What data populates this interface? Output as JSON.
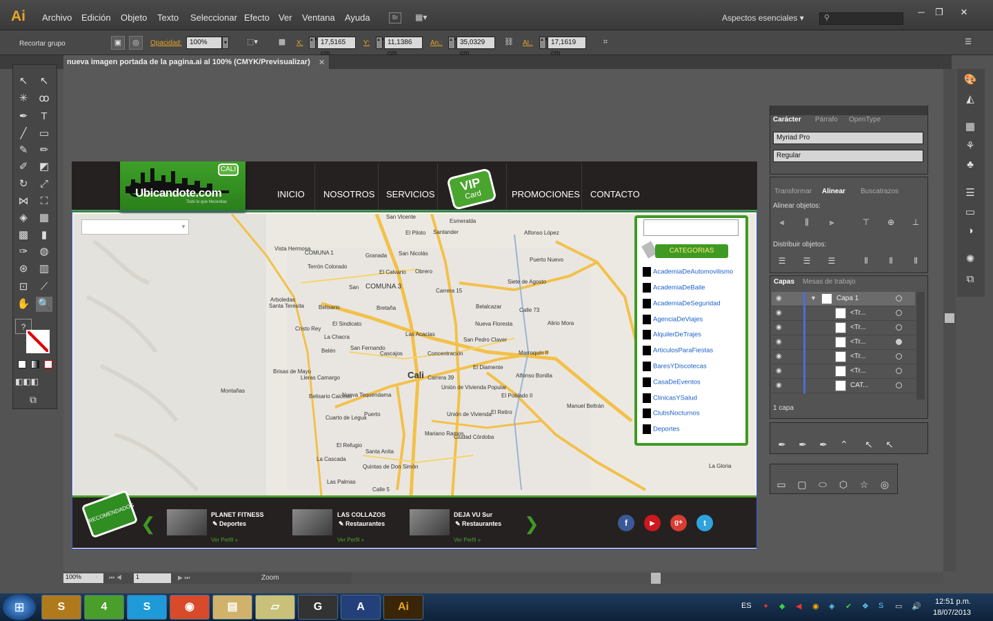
{
  "app": {
    "logo": "Ai",
    "menu": [
      "Archivo",
      "Edición",
      "Objeto",
      "Texto",
      "Seleccionar",
      "Efecto",
      "Ver",
      "Ventana",
      "Ayuda"
    ],
    "bridge": "Br",
    "workspace": "Aspectos esenciales",
    "workspace_caret": "▾",
    "window_controls": [
      "─",
      "❐",
      "✕"
    ]
  },
  "control": {
    "group_label": "Recortar grupo",
    "opacity_label": "Opacidad:",
    "opacity_value": "100%",
    "x_label": "X:",
    "x_value": "17,5165 cm",
    "y_label": "Y:",
    "y_value": "11,1386 cm",
    "w_label": "An.:",
    "w_value": "35,0329 cm",
    "h_label": "Al.:",
    "h_value": "17,1619 cm"
  },
  "document": {
    "tab_title": "nueva imagen portada de la pagina.ai al 100% (CMYK/Previsualizar)",
    "close": "✕"
  },
  "site": {
    "logo_text": "Ubicandote.com",
    "logo_badge": "CALI",
    "logo_sub": "Todo lo que Necesitas",
    "nav": [
      "INICIO",
      "NOSOTROS",
      "SERVICIOS",
      "PROMOCIONES",
      "CONTACTO"
    ],
    "vip_title": "VIP",
    "vip_sub": "Card",
    "categories_title": "CATEGORIAS",
    "categories": [
      "AcademiaDeAutomovilismo",
      "AcademiaDeBaile",
      "AcademiaDeSeguridad",
      "AgenciaDeViajes",
      "AlquilerDeTrajes",
      "ArticulosParaFiestas",
      "BaresYDiscotecas",
      "CasaDeEventos",
      "ClinicasYSalud",
      "ClubsNocturnos",
      "Deportes"
    ],
    "recommended": "RECOMENDADOS",
    "featured": [
      {
        "name": "PLANET FITNESS",
        "category": "Deportes",
        "link": "Ver Perfil »"
      },
      {
        "name": "LAS COLLAZOS",
        "category": "Restaurantes",
        "link": "Ver Perfil »"
      },
      {
        "name": "DEJA VU Sur",
        "category": "Restaurantes",
        "link": "Ver Perfil »"
      }
    ],
    "social": [
      "f",
      "▶",
      "g+",
      "t"
    ]
  },
  "map_labels": [
    "San Vicente",
    "Esmeralda",
    "El Piloto",
    "Santander",
    "Alfonso López",
    "Vista Hermosa",
    "COMUNA 1",
    "Granada",
    "San Nicolás",
    "Terrón Colorado",
    "El Calvario",
    "Obrero",
    "Puerto Nuevo",
    "San",
    "COMUNA 3",
    "Carrera 15",
    "Siete de Agosto",
    "Arboledas",
    "Bretaña",
    "Calle 73",
    "Belisario",
    "Santa Teresita",
    "Belalcazar",
    "El Sindicato",
    "Alirio Mora",
    "La Chacra",
    "Cristo Rey",
    "Nueva Floresta",
    "San Fernando",
    "Las Acacias",
    "San Pedro Claver",
    "Belén",
    "Cascajos",
    "Concentración",
    "El Diamente",
    "Marroquín II",
    "Cali",
    "Carrera 39",
    "Alfonso Bonilla",
    "Brisas de Mayo",
    "Lleras Camargo",
    "Belisario Caicedo",
    "Nueva Tequendama",
    "Unión de Vivienda Popular",
    "El Poblado II",
    "Montañas",
    "Puerto",
    "Cuarto de Legua",
    "Unión de Vivienda",
    "El Retiro",
    "Manuel Beltrán",
    "Mariano Ramos",
    "Ciudad Córdoba",
    "El Refugio",
    "La Cascada",
    "Santa Anita",
    "Quintas de Don Simón",
    "Las Palmas",
    "Calle 5",
    "La Gloria"
  ],
  "layers": {
    "tabs": [
      "Capas",
      "Mesas de trabajo"
    ],
    "top": "Capa 1",
    "rows": [
      "<Tr...",
      "<Tr...",
      "<Tr...",
      "<Tr...",
      "<Tr...",
      "CAT..."
    ],
    "count": "1 capa"
  },
  "character": {
    "tabs": [
      "Carácter",
      "Párrafo",
      "OpenType"
    ],
    "font": "Myriad Pro",
    "style": "Regular"
  },
  "align": {
    "tabs": [
      "Transformar",
      "Alinear",
      "Buscatrazos"
    ],
    "align_label": "Alinear objetos:",
    "dist_label": "Distribuir objetos:"
  },
  "status": {
    "zoom": "100%",
    "page": "1",
    "label": "Zoom"
  },
  "taskbar": {
    "lang": "ES",
    "time": "12:51 p.m.",
    "date": "18/07/2013",
    "apps": [
      "S",
      "4",
      "S",
      "◉",
      "▤",
      "▱",
      "G",
      "A",
      "Ai"
    ]
  }
}
